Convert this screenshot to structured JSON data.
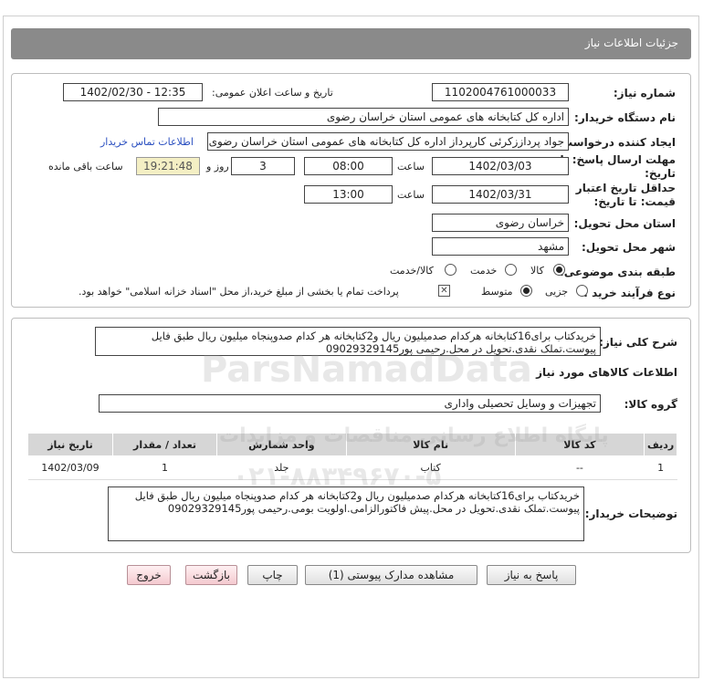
{
  "header": {
    "title": "جزئیات اطلاعات نیاز"
  },
  "form": {
    "need_number_label": "شماره نیاز:",
    "need_number": "1102004761000033",
    "announce_label": "تاریخ و ساعت اعلان عمومی:",
    "announce_value": "1402/02/30 - 12:35",
    "buyer_org_label": "نام دستگاه خریدار:",
    "buyer_org": "اداره کل کتابخانه های عمومی استان خراسان رضوی",
    "creator_label": "ایجاد کننده درخواست:",
    "creator": "جواد پرداززکرئی کارپرداز  اداره کل کتابخانه های عمومی استان خراسان رضوی",
    "contact_link": "اطلاعات تماس خریدار",
    "deadline_label_1": "مهلت ارسال پاسخ: تا",
    "deadline_label_2": "تاریخ:",
    "deadline_date": "1402/03/03",
    "time_label": "ساعت",
    "deadline_time": "08:00",
    "days_value": "3",
    "days_label": "روز و",
    "remaining_time": "19:21:48",
    "remaining_label": "ساعت باقی مانده",
    "validity_label_1": "حداقل تاریخ اعتبار",
    "validity_label_2": "قیمت: تا تاریخ:",
    "validity_date": "1402/03/31",
    "validity_time_label": "ساعت",
    "validity_time": "13:00",
    "province_label": "استان محل تحویل:",
    "province": "خراسان رضوی",
    "city_label": "شهر محل تحویل:",
    "city": "مشهد",
    "category_label": "طبقه بندی موضوعی:",
    "category_options": [
      "کالا",
      "خدمت",
      "کالا/خدمت"
    ],
    "category_selected": "کالا",
    "process_label": "نوع فرآیند خرید :",
    "process_options": [
      "جزیی",
      "متوسط"
    ],
    "process_selected": "متوسط",
    "payment_note": "پرداخت تمام یا بخشی از مبلغ خرید،از محل \"اسناد خزانه اسلامی\" خواهد بود."
  },
  "details": {
    "summary_label": "شرح کلی نیاز:",
    "summary_text": "خریدکتاب برای16کتابخانه هرکدام صدمیلیون ریال و2کتابخانه هر کدام صدوپنجاه میلیون ریال طبق فایل پیوست.تملک نقدی.تحویل در محل.رحیمی پور09029329145",
    "goods_info_title": "اطلاعات کالاهای مورد نیاز",
    "goods_group_label": "گروه کالا:",
    "goods_group": "تجهیزات و وسایل تحصیلی واداری",
    "table": {
      "headers": [
        "ردیف",
        "کد کالا",
        "نام کالا",
        "واحد شمارش",
        "تعداد / مقدار",
        "تاریخ نیاز"
      ],
      "rows": [
        [
          "1",
          "--",
          "کتاب",
          "جلد",
          "1",
          "1402/03/09"
        ]
      ]
    },
    "buyer_desc_label": "توضیحات خریدار:",
    "buyer_desc": "خریدکتاب برای16کتابخانه هرکدام صدمیلیون ریال و2کتابخانه هر کدام صدوپنجاه میلیون ریال طبق فایل پیوست.تملک نقدی.تحویل در محل.پیش فاکتورالزامی.اولویت بومی.رحیمی پور09029329145"
  },
  "buttons": {
    "reply": "پاسخ به نیاز",
    "view_docs": "مشاهده مدارک پیوستی (1)",
    "print": "چاپ",
    "back": "بازگشت",
    "exit": "خروج"
  },
  "watermark": {
    "brand": "ParsNamadData",
    "tagline": "پایگاه اطلاع رسانی مناقصات و مزایدات",
    "phone": "۰۲۱-۸۸۳۴۹۶۷۰-۵"
  },
  "colors": {
    "header_bg": "#8a8a8a",
    "link": "#2a4fc0",
    "timer_bg": "#f4efc4",
    "table_head": "#d6d6d6"
  }
}
